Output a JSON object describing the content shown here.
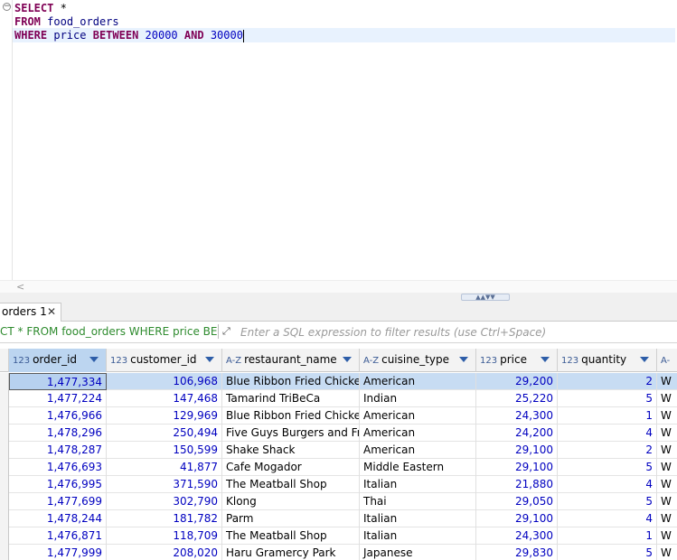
{
  "editor": {
    "lines": [
      [
        {
          "t": "SELECT",
          "c": "kw"
        },
        {
          "t": " *",
          "c": ""
        }
      ],
      [
        {
          "t": "FROM",
          "c": "kw"
        },
        {
          "t": " ",
          "c": ""
        },
        {
          "t": "food_orders",
          "c": "ident"
        }
      ],
      [
        {
          "t": "WHERE",
          "c": "kw"
        },
        {
          "t": " ",
          "c": ""
        },
        {
          "t": "price",
          "c": "ident"
        },
        {
          "t": " ",
          "c": ""
        },
        {
          "t": "BETWEEN",
          "c": "kw"
        },
        {
          "t": " ",
          "c": ""
        },
        {
          "t": "20000",
          "c": "num"
        },
        {
          "t": " ",
          "c": ""
        },
        {
          "t": "AND",
          "c": "kw"
        },
        {
          "t": " ",
          "c": ""
        },
        {
          "t": "30000",
          "c": "num"
        }
      ]
    ]
  },
  "results": {
    "tab_label": "orders 1",
    "tab_close": "✕",
    "filter_query": "CT * FROM food_orders WHERE price BETWE",
    "filter_placeholder": "Enter a SQL expression to filter results (use Ctrl+Space)",
    "columns": [
      {
        "type": "123",
        "name": "order_id"
      },
      {
        "type": "123",
        "name": "customer_id"
      },
      {
        "type": "A-Z",
        "name": "restaurant_name"
      },
      {
        "type": "A-Z",
        "name": "cuisine_type"
      },
      {
        "type": "123",
        "name": "price"
      },
      {
        "type": "123",
        "name": "quantity"
      },
      {
        "type": "A-",
        "name": ""
      }
    ],
    "rows": [
      [
        "1,477,334",
        "106,968",
        "Blue Ribbon Fried Chicken",
        "American",
        "29,200",
        "2",
        "W"
      ],
      [
        "1,477,224",
        "147,468",
        "Tamarind TriBeCa",
        "Indian",
        "25,220",
        "5",
        "W"
      ],
      [
        "1,476,966",
        "129,969",
        "Blue Ribbon Fried Chicken",
        "American",
        "24,300",
        "1",
        "W"
      ],
      [
        "1,478,296",
        "250,494",
        "Five Guys Burgers and Fries",
        "American",
        "24,200",
        "4",
        "W"
      ],
      [
        "1,478,287",
        "150,599",
        "Shake Shack",
        "American",
        "29,100",
        "2",
        "W"
      ],
      [
        "1,476,693",
        "41,877",
        "Cafe Mogador",
        "Middle Eastern",
        "29,100",
        "5",
        "W"
      ],
      [
        "1,476,995",
        "371,590",
        "The Meatball Shop",
        "Italian",
        "21,880",
        "4",
        "W"
      ],
      [
        "1,477,699",
        "302,790",
        "Klong",
        "Thai",
        "29,050",
        "5",
        "W"
      ],
      [
        "1,478,244",
        "181,782",
        "Parm",
        "Italian",
        "29,100",
        "4",
        "W"
      ],
      [
        "1,476,871",
        "118,709",
        "The Meatball Shop",
        "Italian",
        "24,300",
        "1",
        "W"
      ],
      [
        "1,477,999",
        "208,020",
        "Haru Gramercy Park",
        "Japanese",
        "29,830",
        "5",
        "W"
      ]
    ]
  }
}
